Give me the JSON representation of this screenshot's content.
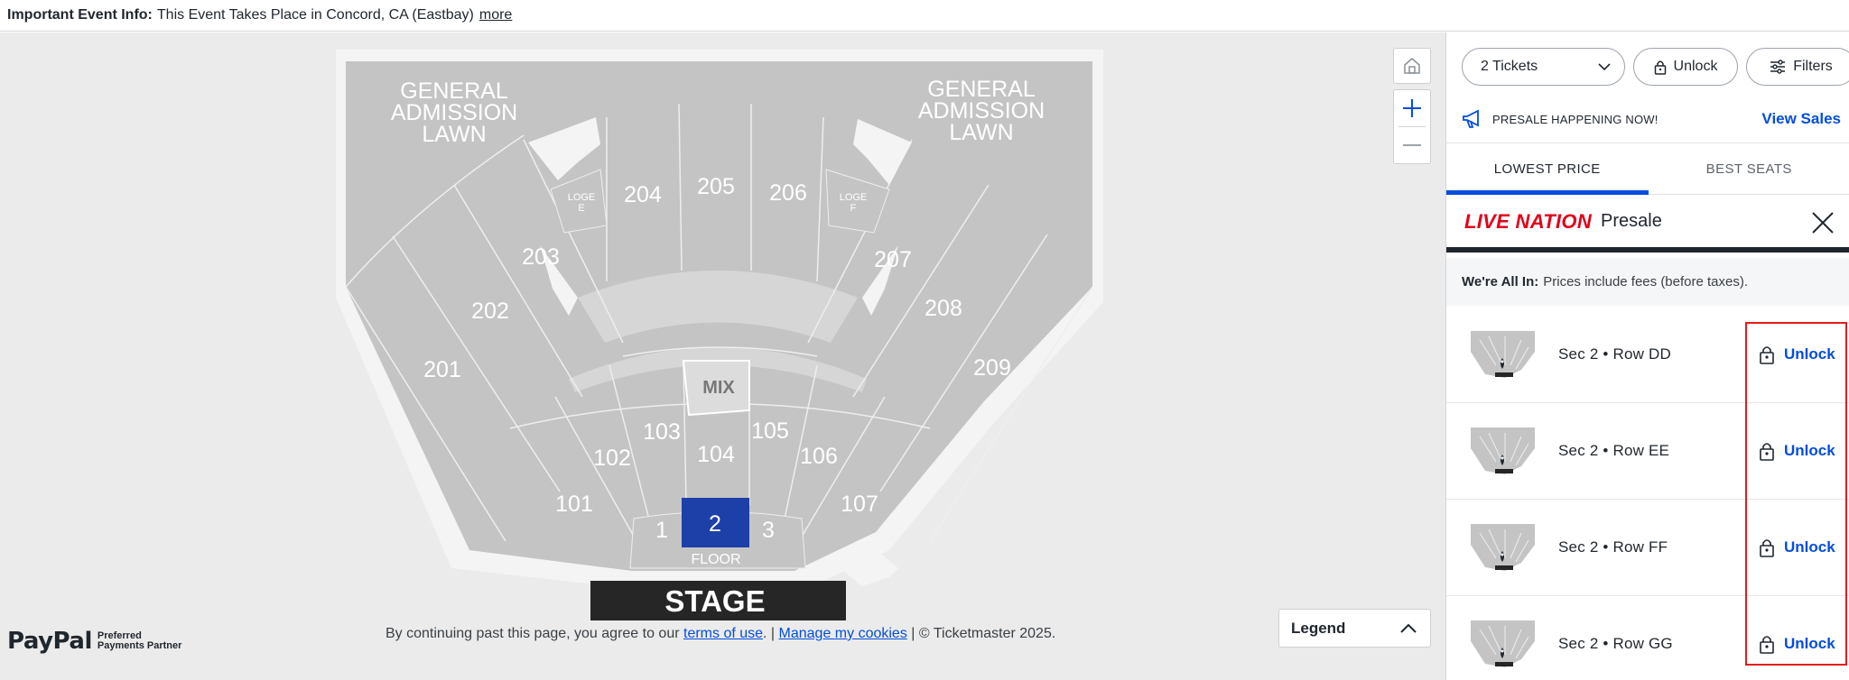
{
  "banner": {
    "label": "Important Event Info:",
    "text": "This Event Takes Place in Concord, CA (Eastbay)",
    "more": "more"
  },
  "map": {
    "sections": {
      "s201": "201",
      "s202": "202",
      "s203": "203",
      "s204": "204",
      "s205": "205",
      "s206": "206",
      "s207": "207",
      "s208": "208",
      "s209": "209",
      "s101": "101",
      "s102": "102",
      "s103": "103",
      "s104": "104",
      "s105": "105",
      "s106": "106",
      "s107": "107",
      "s1": "1",
      "s2": "2",
      "s3": "3"
    },
    "ga_left": [
      "GENERAL",
      "ADMISSION",
      "LAWN"
    ],
    "ga_right": [
      "GENERAL",
      "ADMISSION",
      "LAWN"
    ],
    "loge_e": [
      "LOGE",
      "E"
    ],
    "loge_f": [
      "LOGE",
      "F"
    ],
    "mix": "MIX",
    "floor": "FLOOR",
    "stage": "STAGE",
    "selected_section": "2",
    "colors": {
      "available": "#c2c2c2",
      "selected": "#1d3fa8",
      "background": "#ebebeb",
      "stage": "#262626"
    }
  },
  "controls": {
    "legend": "Legend"
  },
  "paypal": {
    "logo": "PayPal",
    "line1": "Preferred",
    "line2": "Payments Partner"
  },
  "footer": {
    "prefix": "By continuing past this page, you agree to our",
    "terms": "terms of use",
    "sep1": ". |",
    "cookies": "Manage my cookies",
    "suffix": "| © Ticketmaster 2025."
  },
  "panel": {
    "tickets": "2 Tickets",
    "unlock": "Unlock",
    "filters": "Filters",
    "presale_text": "PRESALE HAPPENING NOW!",
    "view_sales": "View Sales",
    "tabs": [
      "LOWEST PRICE",
      "BEST SEATS"
    ],
    "active_tab": "LOWEST PRICE",
    "ln_logo": "LIVE NATION",
    "ln_presale": "Presale",
    "fees_bold": "We're All In:",
    "fees_text": "Prices include fees (before taxes).",
    "listings": [
      {
        "seat": "Sec 2 • Row DD",
        "action": "Unlock"
      },
      {
        "seat": "Sec 2 • Row EE",
        "action": "Unlock"
      },
      {
        "seat": "Sec 2 • Row FF",
        "action": "Unlock"
      },
      {
        "seat": "Sec 2 • Row GG",
        "action": "Unlock"
      }
    ],
    "accent": "#024ddf"
  }
}
